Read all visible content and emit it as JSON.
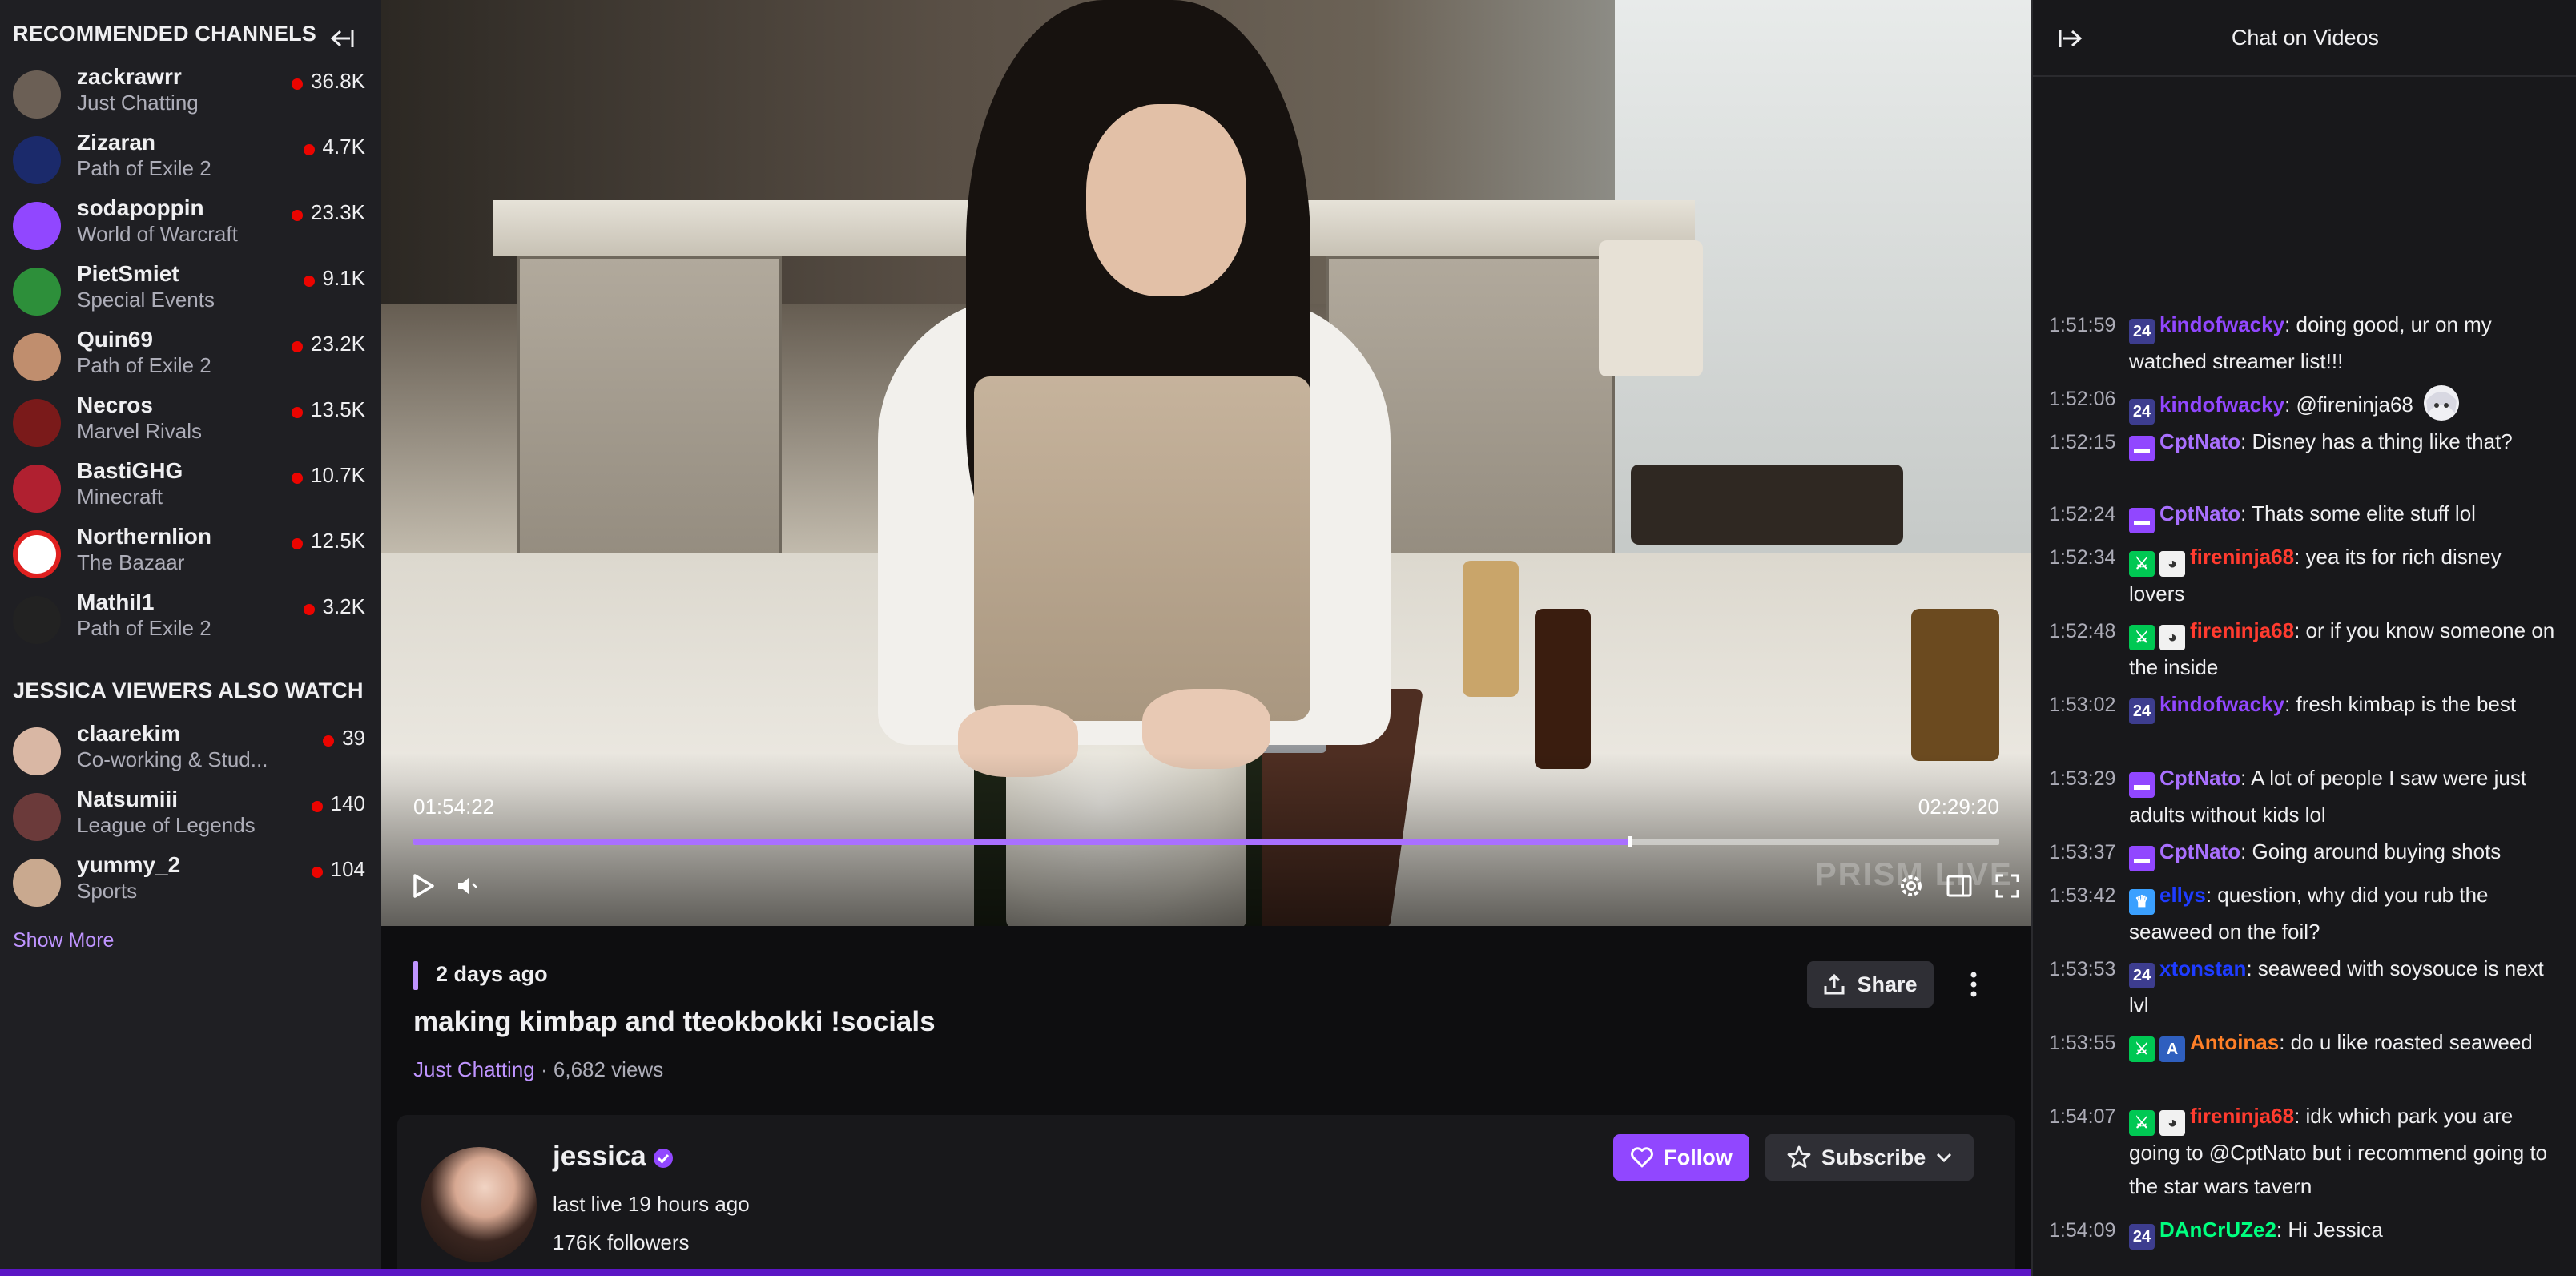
{
  "sidebar": {
    "recommended_heading": "RECOMMENDED CHANNELS",
    "also_watch_heading": "JESSICA VIEWERS ALSO WATCH",
    "show_more": "Show More",
    "recommended": [
      {
        "name": "zackrawrr",
        "category": "Just Chatting",
        "viewers": "36.8K"
      },
      {
        "name": "Zizaran",
        "category": "Path of Exile 2",
        "viewers": "4.7K"
      },
      {
        "name": "sodapoppin",
        "category": "World of Warcraft",
        "viewers": "23.3K"
      },
      {
        "name": "PietSmiet",
        "category": "Special Events",
        "viewers": "9.1K"
      },
      {
        "name": "Quin69",
        "category": "Path of Exile 2",
        "viewers": "23.2K"
      },
      {
        "name": "Necros",
        "category": "Marvel Rivals",
        "viewers": "13.5K"
      },
      {
        "name": "BastiGHG",
        "category": "Minecraft",
        "viewers": "10.7K"
      },
      {
        "name": "Northernlion",
        "category": "The Bazaar",
        "viewers": "12.5K"
      },
      {
        "name": "Mathil1",
        "category": "Path of Exile 2",
        "viewers": "3.2K"
      }
    ],
    "also_watch": [
      {
        "name": "claarekim",
        "category": "Co-working & Stud...",
        "viewers": "39"
      },
      {
        "name": "Natsumiii",
        "category": "League of Legends",
        "viewers": "140"
      },
      {
        "name": "yummy_2",
        "category": "Sports",
        "viewers": "104"
      }
    ]
  },
  "player": {
    "current_time": "01:54:22",
    "duration": "02:29:20",
    "progress_fraction": 0.767,
    "watermark": "PRISM LIVE"
  },
  "video_info": {
    "posted": "2 days ago",
    "title": "making kimbap and tteokbokki !socials",
    "category": "Just Chatting",
    "separator": "·",
    "views": "6,682 views",
    "share_label": "Share"
  },
  "channel": {
    "name": "jessica",
    "last_live": "last live 19 hours ago",
    "followers": "176K followers",
    "follow_label": "Follow",
    "subscribe_label": "Subscribe"
  },
  "chat": {
    "title": "Chat on Videos",
    "messages": [
      {
        "time": "1:51:59",
        "badges": [
          "24"
        ],
        "user": "kindofwacky",
        "color": "#9147ff",
        "text": ": doing good, ur on my watched streamer list!!!"
      },
      {
        "time": "1:52:06",
        "badges": [
          "24"
        ],
        "user": "kindofwacky",
        "color": "#9147ff",
        "text": ": @fireninja68",
        "emote": true
      },
      {
        "time": "1:52:15",
        "badges": [
          "sub"
        ],
        "user": "CptNato",
        "color": "#a970ff",
        "text": ": Disney has a thing like that?"
      },
      {
        "time": "1:52:24",
        "badges": [
          "sub"
        ],
        "user": "CptNato",
        "color": "#a970ff",
        "text": ": Thats some elite stuff lol"
      },
      {
        "time": "1:52:34",
        "badges": [
          "sword",
          "dog"
        ],
        "user": "fireninja68",
        "color": "#ff3b2f",
        "text": ": yea its for rich disney lovers"
      },
      {
        "time": "1:52:48",
        "badges": [
          "sword",
          "dog"
        ],
        "user": "fireninja68",
        "color": "#ff3b2f",
        "text": ": or if you know someone on the inside"
      },
      {
        "time": "1:53:02",
        "badges": [
          "24"
        ],
        "user": "kindofwacky",
        "color": "#9147ff",
        "text": ": fresh kimbap is the best"
      },
      {
        "time": "1:53:29",
        "badges": [
          "sub"
        ],
        "user": "CptNato",
        "color": "#a970ff",
        "text": ": A lot of people I saw were just adults without kids lol"
      },
      {
        "time": "1:53:37",
        "badges": [
          "sub"
        ],
        "user": "CptNato",
        "color": "#a970ff",
        "text": ": Going around buying shots"
      },
      {
        "time": "1:53:42",
        "badges": [
          "crown"
        ],
        "user": "ellys",
        "color": "#1e3cff",
        "text": ": question, why did you rub the seaweed on the foil?"
      },
      {
        "time": "1:53:53",
        "badges": [
          "24"
        ],
        "user": "xtonstan",
        "color": "#1e3cff",
        "text": ": seaweed with soysouce is next lvl"
      },
      {
        "time": "1:53:55",
        "badges": [
          "sword",
          "a"
        ],
        "user": "Antoinas",
        "color": "#ff7f27",
        "text": ": do u like roasted seaweed"
      },
      {
        "time": "1:54:07",
        "badges": [
          "sword",
          "dog"
        ],
        "user": "fireninja68",
        "color": "#ff3b2f",
        "text": ": idk which park you are going to @CptNato but i recommend going to the star wars tavern"
      },
      {
        "time": "1:54:09",
        "badges": [
          "24"
        ],
        "user": "DAnCrUZe2",
        "color": "#00ff7f",
        "text": ": Hi Jessica"
      }
    ]
  },
  "colors": {
    "accent": "#9147ff",
    "accent_light": "#bf94ff",
    "live": "#eb0400",
    "sidebar_bg": "#1f1f23",
    "chat_bg": "#18181b"
  }
}
